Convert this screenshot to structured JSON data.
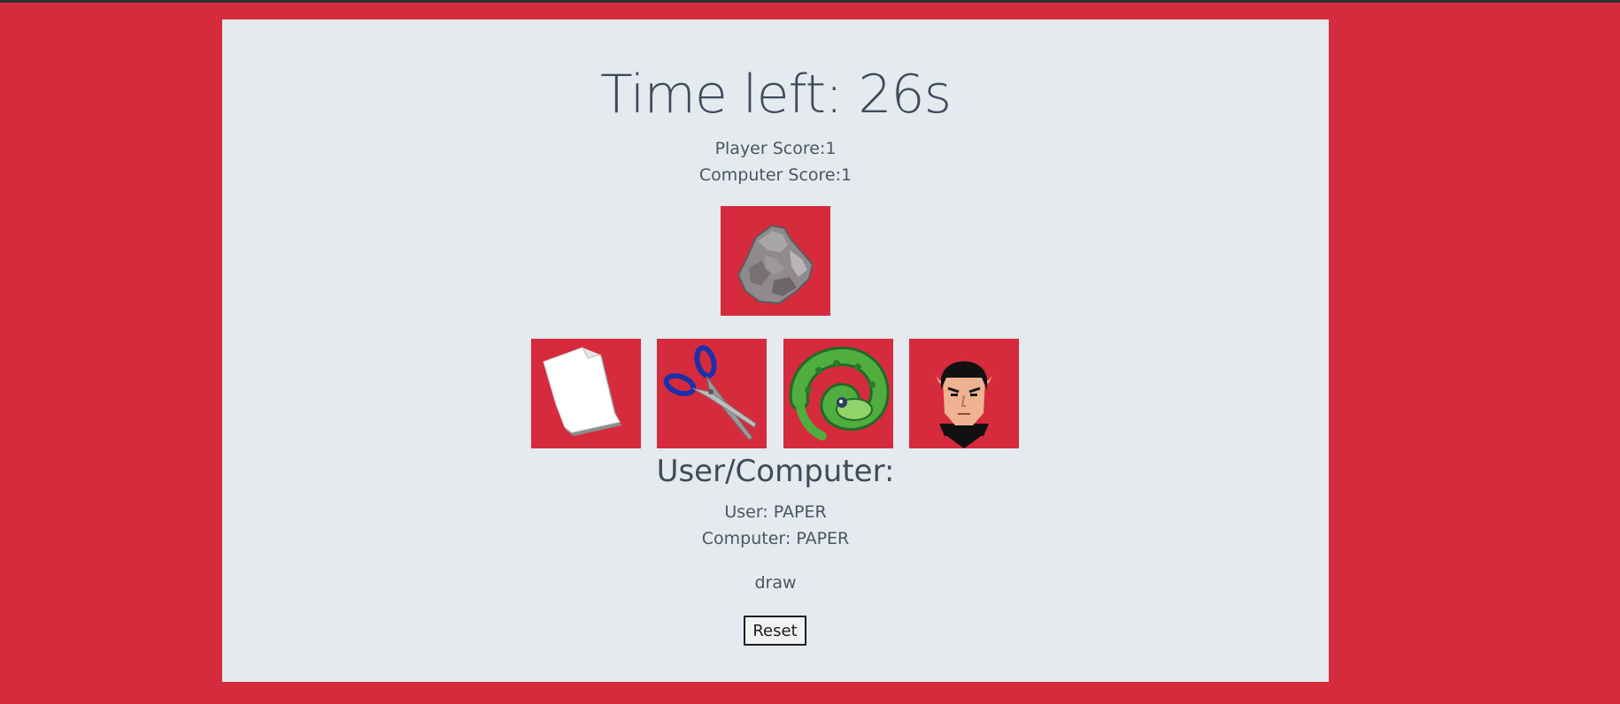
{
  "game": {
    "timer_text": "Time left: 26s",
    "player_score": "Player Score:1",
    "computer_score": "Computer Score:1",
    "choices_heading": "User/Computer:",
    "user_choice": "User: PAPER",
    "computer_choice": "Computer: PAPER",
    "result": "draw",
    "reset_label": "Reset"
  },
  "tiles": [
    {
      "name": "rock",
      "icon": "rock-icon"
    },
    {
      "name": "paper",
      "icon": "paper-icon"
    },
    {
      "name": "scissors",
      "icon": "scissors-icon"
    },
    {
      "name": "lizard",
      "icon": "lizard-icon"
    },
    {
      "name": "spock",
      "icon": "spock-icon"
    }
  ],
  "colors": {
    "background": "#d62b3d",
    "panel": "#e5eaef",
    "text": "#3f4b5b",
    "tile": "#d62b3d"
  }
}
